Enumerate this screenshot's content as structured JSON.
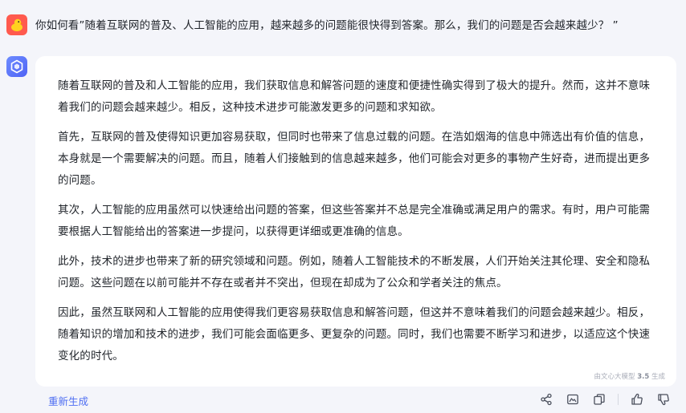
{
  "conversation": {
    "user": {
      "avatar_icon": "duck-avatar-icon",
      "question": "你如何看”随着互联网的普及、人工智能的应用，越来越多的问题能很快得到答案。那么，我们的问题是否会越来越少？ ”"
    },
    "assistant": {
      "avatar_icon": "ernie-bot-logo-icon",
      "paragraphs": [
        "随着互联网的普及和人工智能的应用，我们获取信息和解答问题的速度和便捷性确实得到了极大的提升。然而，这并不意味着我们的问题会越来越少。相反，这种技术进步可能激发更多的问题和求知欲。",
        "首先，互联网的普及使得知识更加容易获取，但同时也带来了信息过载的问题。在浩如烟海的信息中筛选出有价值的信息，本身就是一个需要解决的问题。而且，随着人们接触到的信息越来越多，他们可能会对更多的事物产生好奇，进而提出更多的问题。",
        "其次，人工智能的应用虽然可以快速给出问题的答案，但这些答案并不总是完全准确或满足用户的需求。有时，用户可能需要根据人工智能给出的答案进一步提问，以获得更详细或更准确的信息。",
        "此外，技术的进步也带来了新的研究领域和问题。例如，随着人工智能技术的不断发展，人们开始关注其伦理、安全和隐私问题。这些问题在以前可能并不存在或者并不突出，但现在却成为了公众和学者关注的焦点。",
        "因此，虽然互联网和人工智能的应用使得我们更容易获取信息和解答问题，但这并不意味着我们的问题会越来越少。相反，随着知识的增加和技术的进步，我们可能会面临更多、更复杂的问题。同时，我们也需要不断学习和进步，以适应这个快速变化的时代。"
      ],
      "generated_by_prefix": "由文心大模型",
      "model_version": "3.5",
      "generated_by_suffix": "生成"
    }
  },
  "toolbar": {
    "regenerate_label": "重新生成",
    "action_icons": [
      "share-icon",
      "image-icon",
      "copy-icon",
      "thumbs-up-icon",
      "thumbs-down-icon"
    ]
  },
  "colors": {
    "page_bg": "#f4f5fa",
    "card_bg": "#ffffff",
    "accent": "#4e6ef2",
    "user_avatar": "#ff5a4e",
    "bot_avatar": "#5b74f7"
  }
}
